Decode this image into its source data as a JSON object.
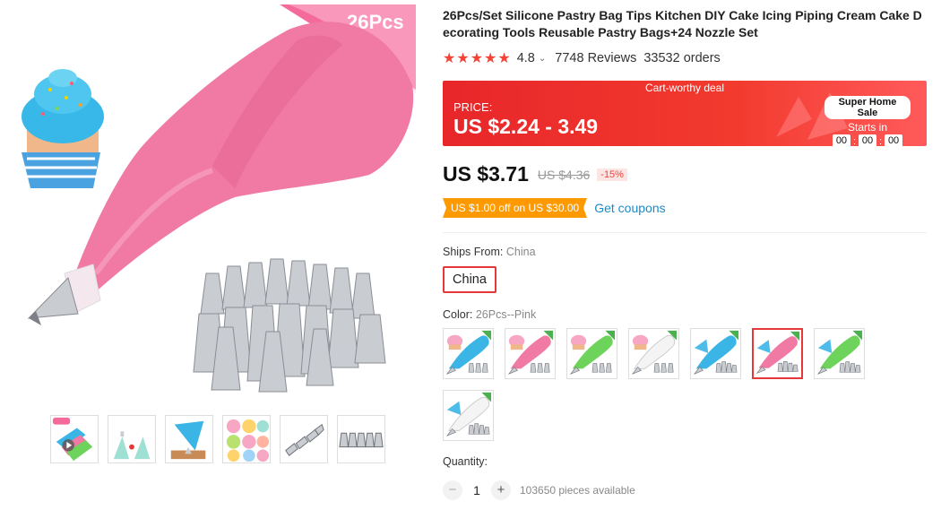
{
  "gallery": {
    "badge_text": "26Pcs",
    "thumbnail_count": 6,
    "colors": {
      "bag_pink": "#f17aa5",
      "badge_pink": "#f46a9b",
      "metal": "#c9ccd1"
    }
  },
  "product": {
    "title": "26Pcs/Set Silicone Pastry Bag Tips Kitchen DIY Cake Icing Piping Cream Cake Decorating Tools Reusable Pastry Bags+24 Nozzle Set",
    "rating": "4.8",
    "stars": "★★★★★",
    "reviews": "7748 Reviews",
    "orders": "33532 orders"
  },
  "deal": {
    "label": "Cart-worthy deal",
    "price_label": "PRICE:",
    "price_range": "US $2.24 - 3.49",
    "sale_title": "Super Home Sale",
    "starts_in": "Starts in",
    "timer": [
      "00",
      "00",
      "00"
    ],
    "colors": {
      "banner": "#e8262a"
    }
  },
  "price": {
    "current": "US $3.71",
    "original": "US $4.36",
    "discount": "-15%"
  },
  "coupon": {
    "badge": "US $1.00 off on US $30.00",
    "link": "Get coupons",
    "colors": {
      "badge": "#ff9900",
      "link": "#1a8bc9"
    }
  },
  "shipping": {
    "label": "Ships From:",
    "value": "China",
    "options": [
      "China"
    ]
  },
  "color": {
    "label": "Color:",
    "selected": "26Pcs--Pink",
    "swatches": [
      {
        "icon": "blue-bag-cupcake",
        "bag": "#3ab5e6"
      },
      {
        "icon": "pink-bag-cupcake",
        "bag": "#f17aa5"
      },
      {
        "icon": "green-bag-cupcake",
        "bag": "#6dd35a"
      },
      {
        "icon": "white-bag-cupcake",
        "bag": "#f4f4f4"
      },
      {
        "icon": "blue-bag-tips",
        "bag": "#3ab5e6"
      },
      {
        "icon": "pink-bag-tips",
        "bag": "#f17aa5",
        "selected": true
      },
      {
        "icon": "green-bag-tips",
        "bag": "#6dd35a"
      },
      {
        "icon": "white-bag-tips",
        "bag": "#f4f4f4"
      }
    ]
  },
  "quantity": {
    "label": "Quantity:",
    "value": "1",
    "minus": "−",
    "plus": "+",
    "available": "103650 pieces available"
  }
}
